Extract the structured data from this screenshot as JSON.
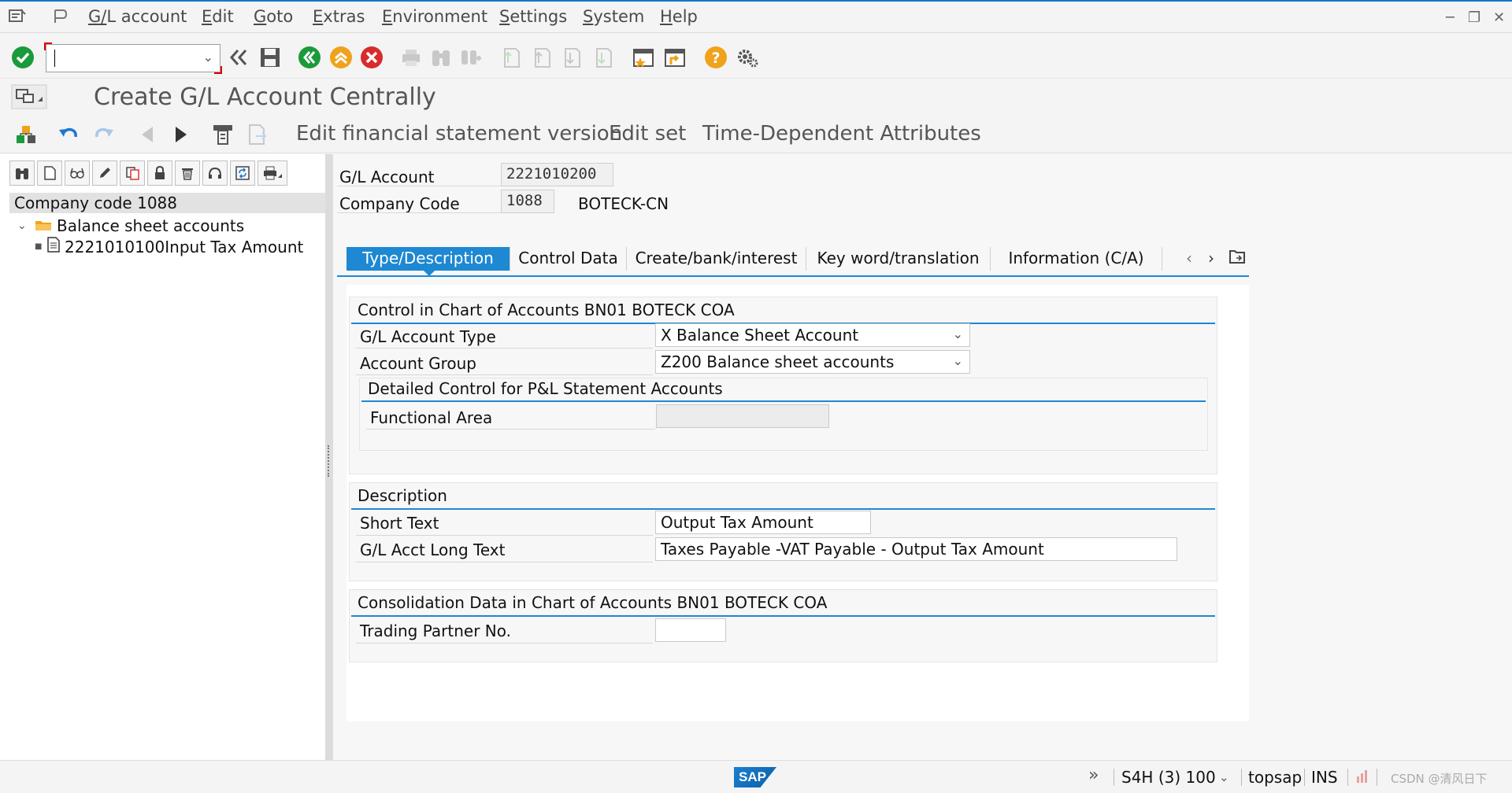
{
  "menubar": {
    "items": [
      "G/L account",
      "Edit",
      "Goto",
      "Extras",
      "Environment",
      "Settings",
      "System",
      "Help"
    ]
  },
  "toolbar": {
    "command_value": ""
  },
  "title": "Create G/L Account Centrally",
  "app_toolbar": {
    "buttons": [
      "Edit financial statement version",
      "Edit set",
      "Time-Dependent Attributes"
    ]
  },
  "tree": {
    "header": "Company code 1088",
    "folder": "Balance sheet accounts",
    "leaf": "2221010100Input Tax Amount"
  },
  "header": {
    "gl_account_label": "G/L Account",
    "gl_account_value": "2221010200",
    "company_code_label": "Company Code",
    "company_code_value": "1088",
    "company_name": "BOTECK-CN"
  },
  "tabs": [
    "Type/Description",
    "Control Data",
    "Create/bank/interest",
    "Key word/translation",
    "Information (C/A)"
  ],
  "groups": {
    "control": {
      "title": "Control in Chart of Accounts BN01 BOTECK COA",
      "account_type_label": "G/L Account Type",
      "account_type_value": "X Balance Sheet Account",
      "account_group_label": "Account Group",
      "account_group_value": "Z200 Balance sheet accounts",
      "pl_title": "Detailed Control for P&L Statement Accounts",
      "functional_area_label": "Functional Area",
      "functional_area_value": ""
    },
    "description": {
      "title": "Description",
      "short_text_label": "Short Text",
      "short_text_value": "Output Tax Amount",
      "long_text_label": "G/L Acct Long Text",
      "long_text_value": "Taxes Payable -VAT Payable - Output Tax Amount"
    },
    "consolidation": {
      "title": "Consolidation Data in Chart of Accounts BN01 BOTECK COA",
      "trading_partner_label": "Trading Partner No.",
      "trading_partner_value": ""
    }
  },
  "statusbar": {
    "system": "S4H (3) 100",
    "server": "topsap",
    "mode": "INS",
    "logo": "SAP",
    "watermark": "CSDN @清风日下"
  },
  "colors": {
    "accent": "#1e88d2",
    "ok_green": "#1a9b3a",
    "cancel_red": "#d92b2b",
    "exit_orange": "#f0a21b"
  }
}
